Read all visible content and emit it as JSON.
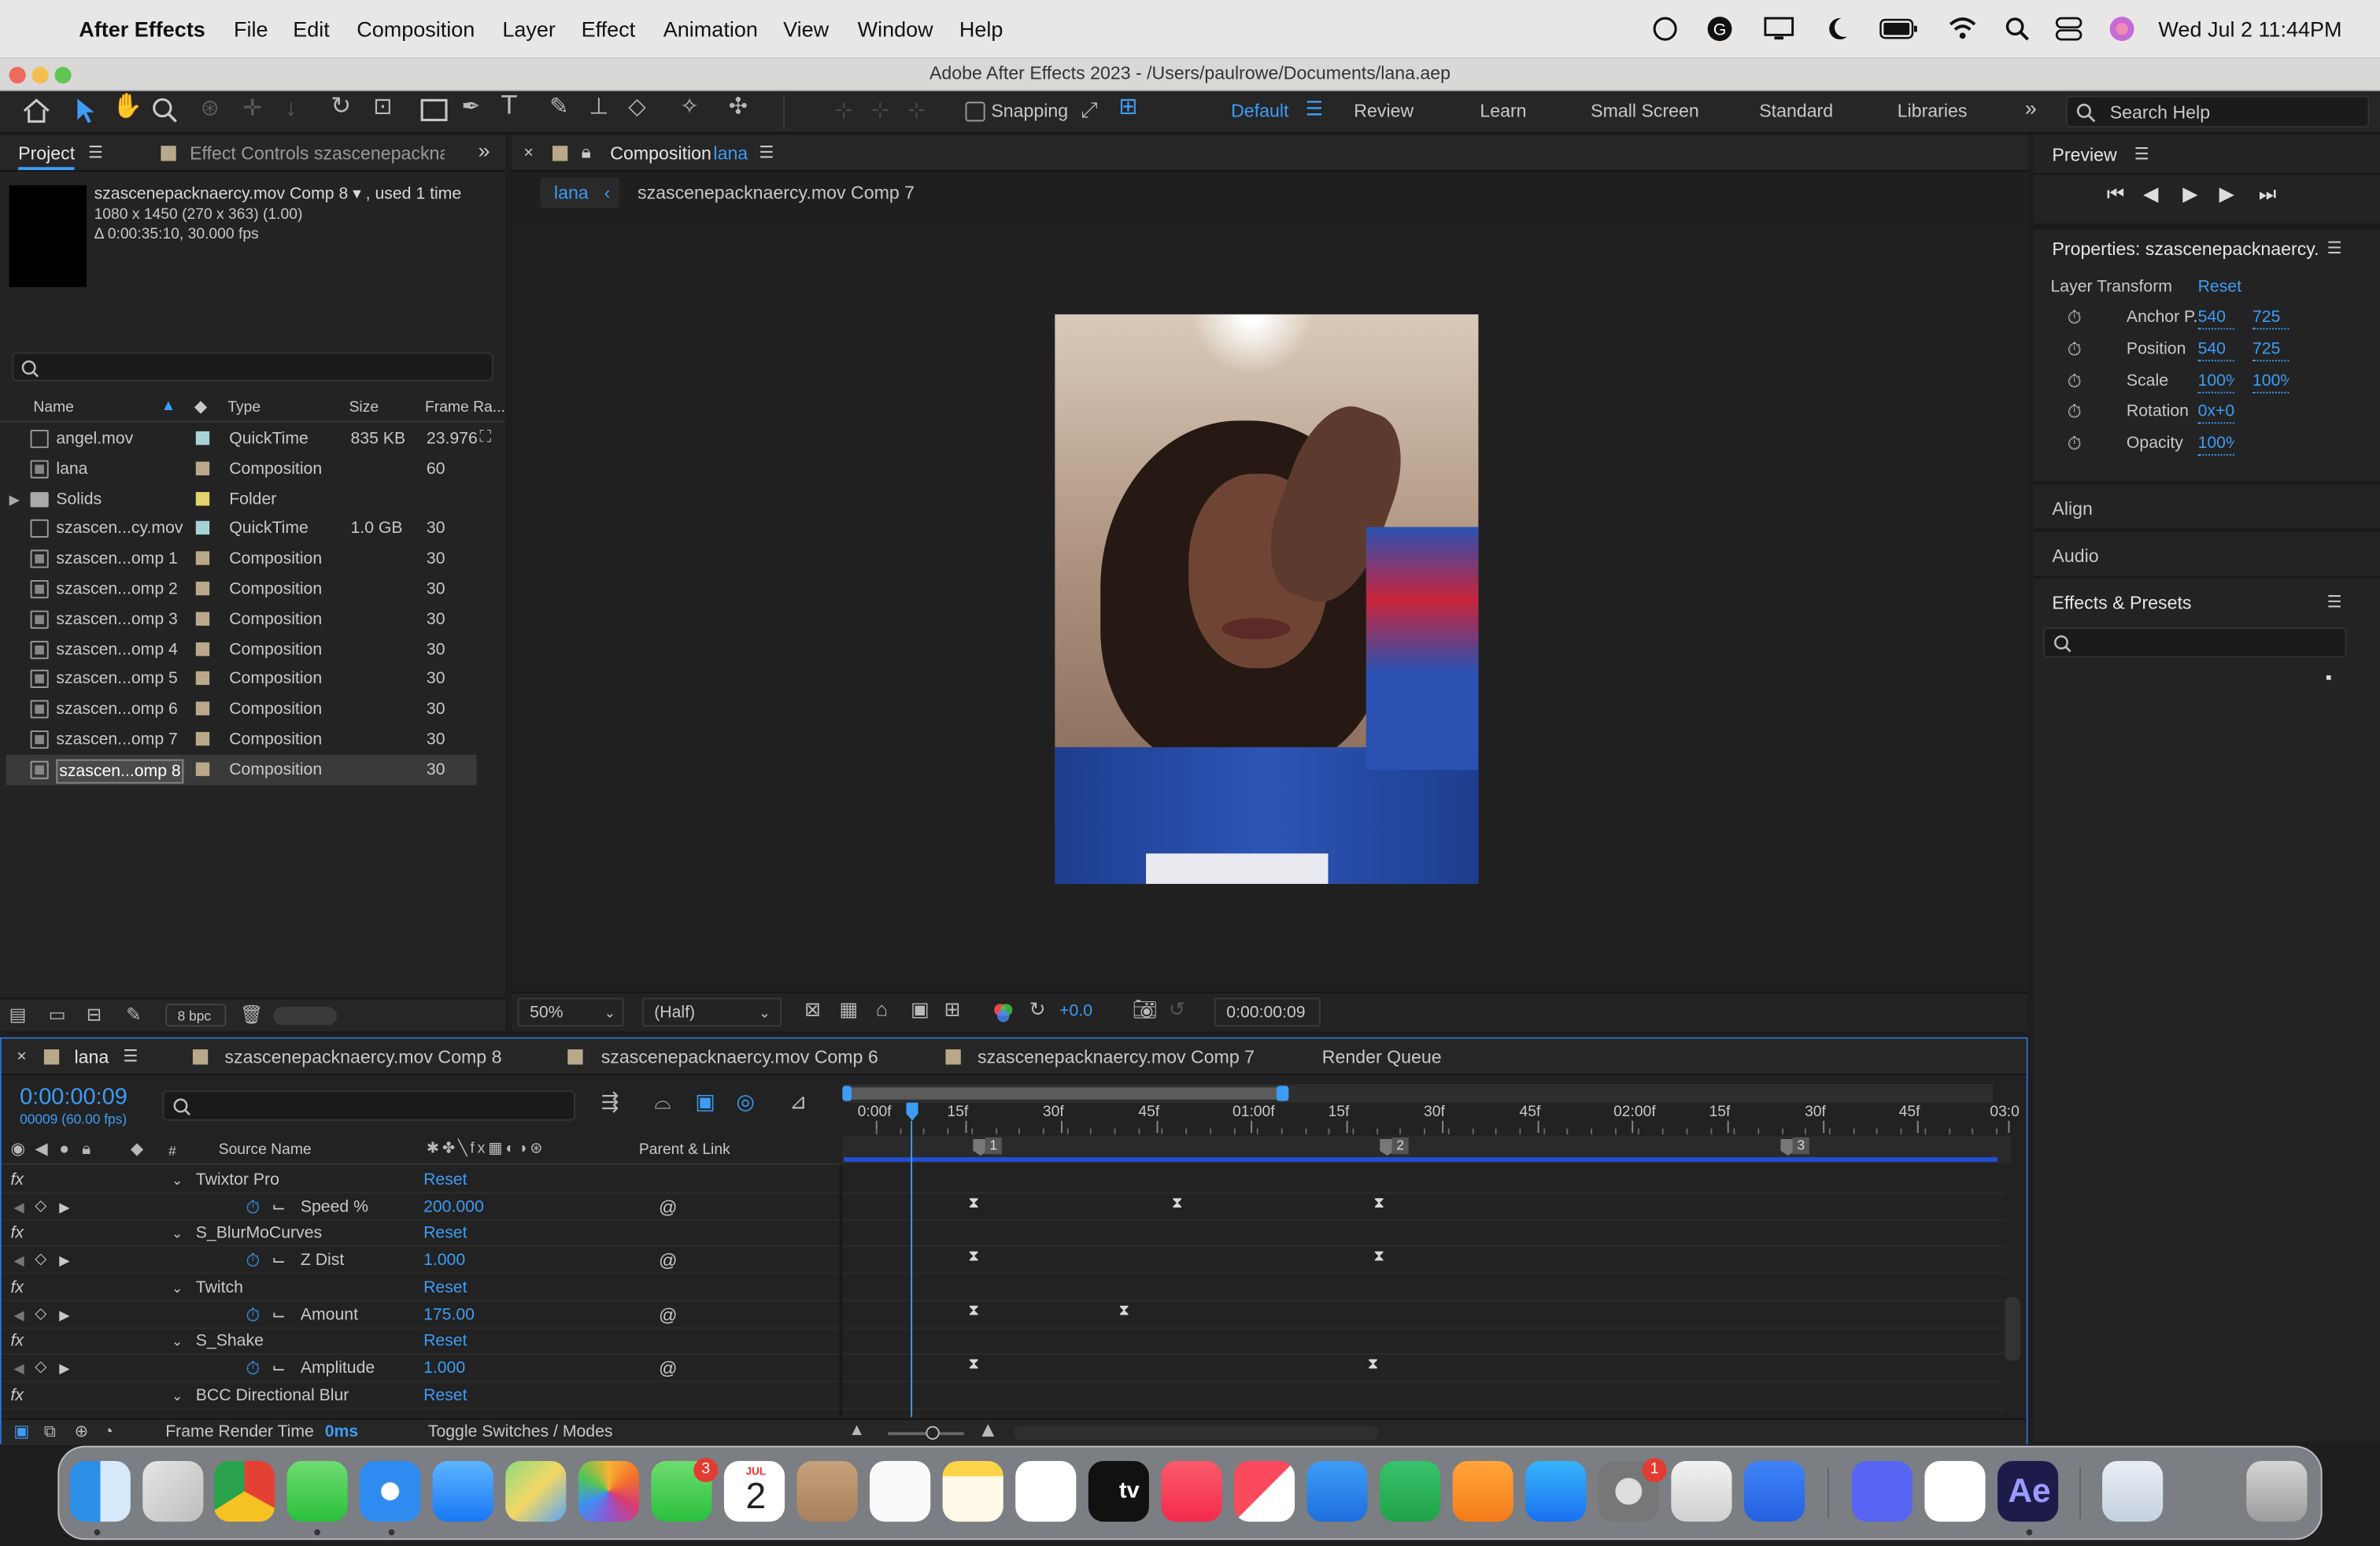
{
  "menubar": {
    "app": "After Effects",
    "items": [
      "File",
      "Edit",
      "Composition",
      "Layer",
      "Effect",
      "Animation",
      "View",
      "Window",
      "Help"
    ],
    "clock": "Wed Jul 2  11:44PM"
  },
  "window": {
    "title": "Adobe After Effects 2023 - /Users/paulrowe/Documents/lana.aep"
  },
  "toolbar": {
    "snapping": "Snapping",
    "workspaces": [
      "Default",
      "Review",
      "Learn",
      "Small Screen",
      "Standard",
      "Libraries"
    ],
    "active_workspace": "Default",
    "search_placeholder": "Search Help"
  },
  "project": {
    "tab": "Project",
    "effect_tab": "Effect Controls szascenepacknae",
    "selected_name": "szascenepacknaercy.mov Comp 8 ▾ , used 1 time",
    "selected_dims": "1080 x 1450  (270 x 363) (1.00)",
    "selected_duration": "Δ 0:00:35:10, 30.000 fps",
    "columns": [
      "Name",
      "Type",
      "Size",
      "Frame Ra..."
    ],
    "items": [
      {
        "name": "angel.mov",
        "type": "QuickTime",
        "size": "835 KB",
        "fps": "23.976",
        "color": "#a8d3d6",
        "kind": "file"
      },
      {
        "name": "lana",
        "type": "Composition",
        "size": "",
        "fps": "60",
        "color": "#b9a98a",
        "kind": "comp"
      },
      {
        "name": "Solids",
        "type": "Folder",
        "size": "",
        "fps": "",
        "color": "#e3d36a",
        "kind": "folder"
      },
      {
        "name": "szascen...cy.mov",
        "type": "QuickTime",
        "size": "1.0 GB",
        "fps": "30",
        "color": "#a8d3d6",
        "kind": "file"
      },
      {
        "name": "szascen...omp 1",
        "type": "Composition",
        "size": "",
        "fps": "30",
        "color": "#b9a98a",
        "kind": "comp"
      },
      {
        "name": "szascen...omp 2",
        "type": "Composition",
        "size": "",
        "fps": "30",
        "color": "#b9a98a",
        "kind": "comp"
      },
      {
        "name": "szascen...omp 3",
        "type": "Composition",
        "size": "",
        "fps": "30",
        "color": "#b9a98a",
        "kind": "comp"
      },
      {
        "name": "szascen...omp 4",
        "type": "Composition",
        "size": "",
        "fps": "30",
        "color": "#b9a98a",
        "kind": "comp"
      },
      {
        "name": "szascen...omp 5",
        "type": "Composition",
        "size": "",
        "fps": "30",
        "color": "#b9a98a",
        "kind": "comp"
      },
      {
        "name": "szascen...omp 6",
        "type": "Composition",
        "size": "",
        "fps": "30",
        "color": "#b9a98a",
        "kind": "comp"
      },
      {
        "name": "szascen...omp 7",
        "type": "Composition",
        "size": "",
        "fps": "30",
        "color": "#b9a98a",
        "kind": "comp"
      },
      {
        "name": "szascen...omp 8",
        "type": "Composition",
        "size": "",
        "fps": "30",
        "color": "#b9a98a",
        "kind": "comp"
      }
    ],
    "bpc": "8 bpc"
  },
  "composition": {
    "tab_label": "Composition",
    "tab_name": "lana",
    "crumbs": [
      "lana",
      "szascenepacknaercy.mov Comp 7"
    ],
    "zoom": "50%",
    "resolution": "(Half)",
    "exposure": "+0.0",
    "timecode": "0:00:00:09"
  },
  "preview": {
    "title": "Preview"
  },
  "properties": {
    "title": "Properties: szascenepacknaercy.mc",
    "section": "Layer Transform",
    "reset": "Reset",
    "rows": [
      {
        "label": "Anchor P.",
        "v1": "540",
        "v2": "725"
      },
      {
        "label": "Position",
        "v1": "540",
        "v2": "725"
      },
      {
        "label": "Scale",
        "v1": "100%",
        "v2": "100%"
      },
      {
        "label": "Rotation",
        "v1": "0x+0°",
        "v2": ""
      },
      {
        "label": "Opacity",
        "v1": "100%",
        "v2": ""
      }
    ]
  },
  "panels": {
    "align": "Align",
    "audio": "Audio",
    "effects": "Effects & Presets"
  },
  "timeline": {
    "tabs": [
      "lana",
      "szascenepacknaercy.mov Comp 8",
      "szascenepacknaercy.mov Comp 6",
      "szascenepacknaercy.mov Comp 7",
      "Render Queue"
    ],
    "timecode": "0:00:00:09",
    "frames": "00009 (60.00 fps)",
    "col_source": "Source Name",
    "col_parent": "Parent & Link",
    "ruler": [
      "0:00f",
      "15f",
      "30f",
      "45f",
      "01:00f",
      "15f",
      "30f",
      "45f",
      "02:00f",
      "15f",
      "30f",
      "45f",
      "03:0"
    ],
    "markers": [
      "1",
      "2",
      "3"
    ],
    "rows": [
      {
        "kind": "effect",
        "name": "Twixtor Pro",
        "value": "Reset"
      },
      {
        "kind": "prop",
        "name": "Speed %",
        "value": "200.000"
      },
      {
        "kind": "effect",
        "name": "S_BlurMoCurves",
        "value": "Reset"
      },
      {
        "kind": "prop",
        "name": "Z Dist",
        "value": "1.000"
      },
      {
        "kind": "effect",
        "name": "Twitch",
        "value": "Reset"
      },
      {
        "kind": "prop",
        "name": "Amount",
        "value": "175.00"
      },
      {
        "kind": "effect",
        "name": "S_Shake",
        "value": "Reset"
      },
      {
        "kind": "prop",
        "name": "Amplitude",
        "value": "1.000"
      },
      {
        "kind": "effect",
        "name": "BCC Directional Blur",
        "value": "Reset"
      }
    ],
    "frame_render": "Frame Render Time",
    "frame_render_value": "0ms",
    "toggle": "Toggle Switches / Modes"
  },
  "dock": {
    "badge_facetime": "3",
    "badge_settings": "1",
    "calendar_month": "JUL",
    "calendar_day": "2",
    "tv_label": "tv",
    "ae_label": "Ae"
  }
}
